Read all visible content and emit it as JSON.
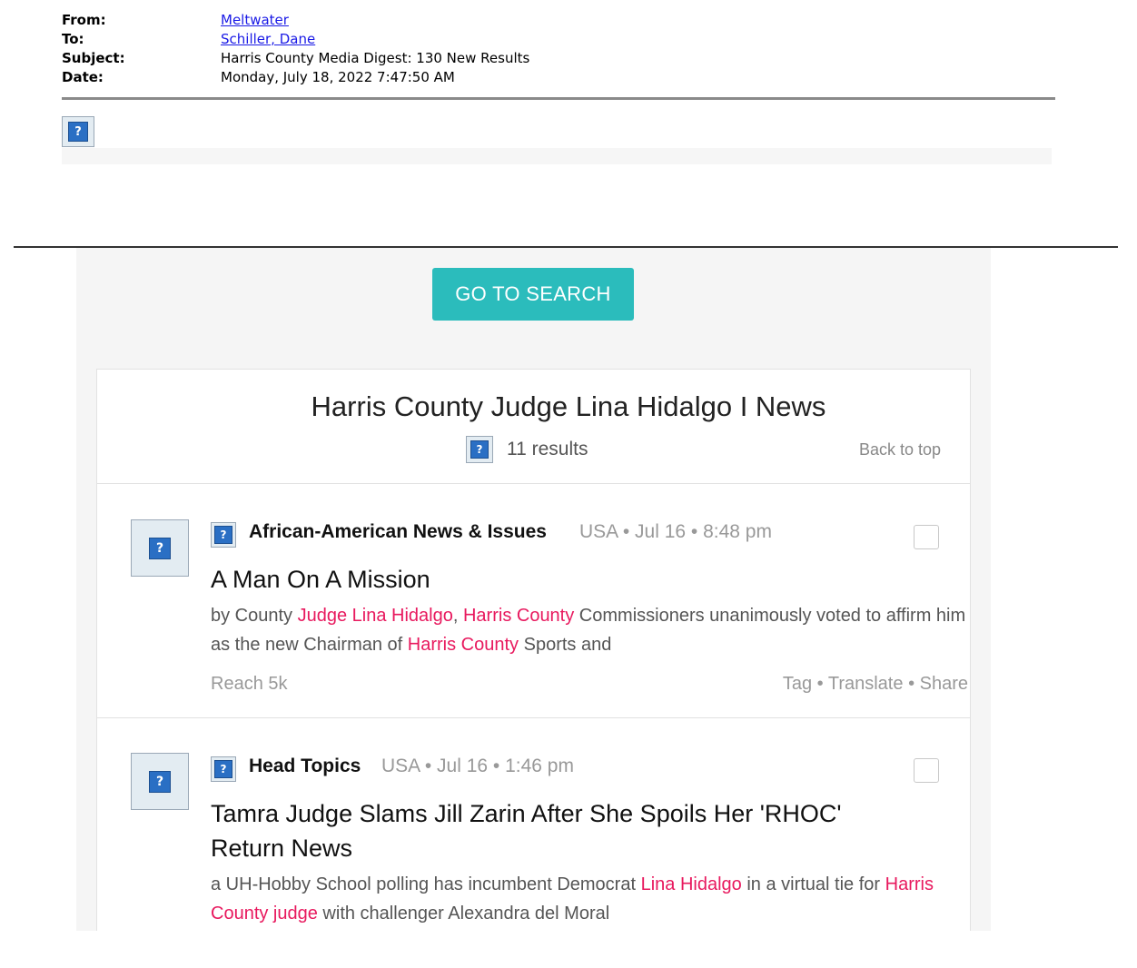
{
  "email": {
    "from_label": "From:",
    "from_value": "Meltwater",
    "to_label": "To:",
    "to_value": "Schiller, Dane",
    "subject_label": "Subject:",
    "subject_value": "Harris County Media Digest: 130 New Results",
    "date_label": "Date:",
    "date_value": "Monday, July 18, 2022 7:47:50 AM"
  },
  "digest": {
    "go_button": "GO TO SEARCH",
    "section_title": "Harris County Judge Lina Hidalgo I News",
    "results_count": "11 results",
    "back_to_top": "Back to top"
  },
  "articles": [
    {
      "source": "African-American News & Issues",
      "meta": "USA • Jul 16 • 8:48 pm",
      "title": "A Man On A Mission",
      "snippet": [
        {
          "t": "by County ",
          "hl": false
        },
        {
          "t": "Judge Lina Hidalgo",
          "hl": true
        },
        {
          "t": ", ",
          "hl": false
        },
        {
          "t": "Harris County",
          "hl": true
        },
        {
          "t": " Commissioners unanimously voted to affirm him as the new Chairman of ",
          "hl": false
        },
        {
          "t": "Harris County",
          "hl": true
        },
        {
          "t": " Sports and",
          "hl": false
        }
      ],
      "reach": "Reach 5k",
      "actions": [
        "Tag",
        "Translate",
        "Share"
      ]
    },
    {
      "source": "Head Topics",
      "meta": "USA • Jul 16 • 1:46 pm",
      "title": "Tamra Judge Slams Jill Zarin After She Spoils Her 'RHOC' Return News",
      "snippet": [
        {
          "t": "a UH-Hobby School polling has incumbent Democrat ",
          "hl": false
        },
        {
          "t": "Lina Hidalgo",
          "hl": true
        },
        {
          "t": " in a virtual tie for ",
          "hl": false
        },
        {
          "t": "Harris County judge",
          "hl": true
        },
        {
          "t": " with challenger Alexandra del Moral",
          "hl": false
        }
      ]
    }
  ],
  "icons": {
    "broken_image_glyph": "?",
    "accent": "#2bbcbc",
    "highlight": "#e8195e"
  }
}
